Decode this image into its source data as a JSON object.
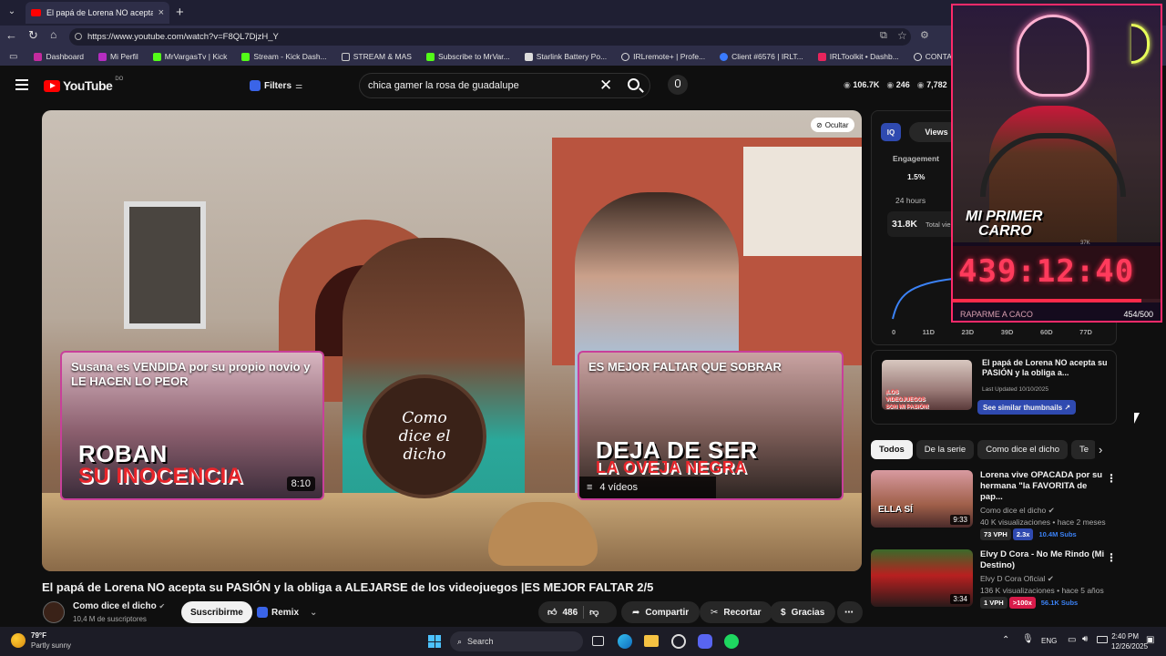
{
  "browser": {
    "tab_title": "El papá de Lorena NO acepta su P",
    "url": "https://www.youtube.com/watch?v=F8QL7DjzH_Y",
    "bookmarks": [
      {
        "label": "Dashboard",
        "color": "#c42b9e"
      },
      {
        "label": "Mi Perfil",
        "color": "#b52dc0"
      },
      {
        "label": "MrVargasTv | Kick",
        "color": "#53fc18"
      },
      {
        "label": "Stream - Kick Dash...",
        "color": "#53fc18"
      },
      {
        "label": "STREAM & MAS",
        "color": "#cfcfcf"
      },
      {
        "label": "Subscribe to MrVar...",
        "color": "#53fc18"
      },
      {
        "label": "Starlink Battery Po...",
        "color": "#dcdcdc"
      },
      {
        "label": "IRLremote+ | Profe...",
        "color": "#dcdcdc"
      },
      {
        "label": "Client #6576 | IRLT...",
        "color": "#3a7bff"
      },
      {
        "label": "IRLToolkit • Dashb...",
        "color": "#e8245c"
      },
      {
        "label": "CONTADOR",
        "color": "#dcdcdc"
      }
    ]
  },
  "youtube": {
    "logo": "YouTube",
    "region": "DO",
    "filters_label": "Filters",
    "search_value": "chica gamer la rosa de guadalupe",
    "stats": {
      "views": "106.7K",
      "likes": "246",
      "other": "7,782"
    }
  },
  "video": {
    "hide_label": "Ocultar",
    "card_left": {
      "title": "Susana es VENDIDA por su propio novio y LE HACEN LO PEOR",
      "line1": "ROBAN",
      "line2": "SU INOCENCIA",
      "duration": "8:10"
    },
    "card_right": {
      "title": "ES MEJOR FALTAR QUE SOBRAR",
      "line1": "DEJA DE SER",
      "line2": "LA OVEJA NEGRA",
      "playlist": "4 vídeos"
    },
    "channel_logo_text": "Como dice el dicho",
    "title": "El papá de Lorena NO acepta su PASIÓN y la obliga a ALEJARSE de los videojuegos |ES MEJOR FALTAR 2/5",
    "channel": "Como dice el dicho",
    "subscribers": "10,4 M de suscriptores",
    "subscribe": "Suscribirme",
    "remix": "Remix",
    "likes": "486",
    "share": "Compartir",
    "clip": "Recortar",
    "thanks": "Gracias"
  },
  "analytics": {
    "iq": "IQ",
    "views_tab": "Views",
    "engagement_label": "Engagement",
    "engagement_value": "1.5%",
    "period": "24 hours",
    "total_views": "31.8K",
    "total_label": "Total vie",
    "x_ticks": [
      "0",
      "11D",
      "23D",
      "39D",
      "60D",
      "77D"
    ]
  },
  "stream_overlay": {
    "title_line1": "MI PRIMER",
    "title_line2": "CARRO",
    "timer": "439:12:40",
    "label": "RAPARME A CACO",
    "progress": "454/500",
    "progress_fraction": 0.908,
    "small_count": "37K"
  },
  "similar": {
    "title": "El papá de Lorena NO acepta su PASIÓN y la obliga a...",
    "updated": "Last Updated 10/10/2025",
    "button": "See similar thumbnails ↗",
    "thumb_text": "¡LOS VIDEOJUEGOS SON MI PASIÓN!"
  },
  "chips": [
    "Todos",
    "De la serie",
    "Como dice el dicho",
    "Te"
  ],
  "recommendations": [
    {
      "title": "Lorena vive OPACADA por su hermana \"la FAVORITA de pap...",
      "channel": "Como dice el dicho",
      "meta": "40 K visualizaciones • hace 2 meses",
      "vph": "73 VPH",
      "ratio": "2.3x",
      "subs": "10.4M Subs",
      "duration": "9:33",
      "thumb_text": "ELLA SÍ"
    },
    {
      "title": "Elvy D Cora - No Me Rindo (Mi Destino)",
      "channel": "Elvy D Cora Oficial",
      "meta": "136 K visualizaciones • hace 5 años",
      "vph": "1 VPH",
      "ratio": ">100x",
      "subs": "56.1K Subs",
      "duration": "3:34",
      "thumb_text": ""
    }
  ],
  "taskbar": {
    "temp": "79°F",
    "weather": "Partly sunny",
    "search": "Search",
    "lang": "ENG",
    "time": "2:40 PM",
    "date": "12/26/2025"
  }
}
